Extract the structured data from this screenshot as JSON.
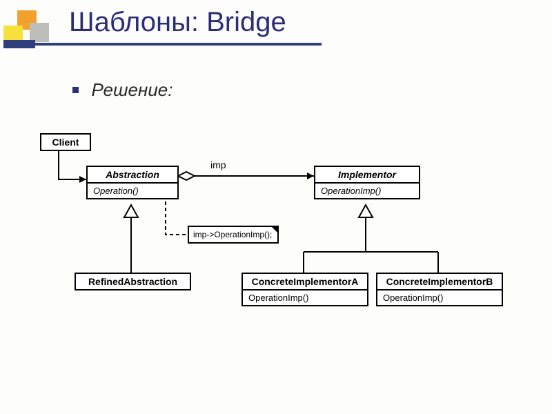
{
  "title": "Шаблоны: Bridge",
  "subtitle": "Решение:",
  "diagram": {
    "client": {
      "name": "Client"
    },
    "abstraction": {
      "name": "Abstraction",
      "method": "Operation()"
    },
    "refined": {
      "name": "RefinedAbstraction"
    },
    "implementor": {
      "name": "Implementor",
      "method": "OperationImp()"
    },
    "concreteA": {
      "name": "ConcreteImplementorA",
      "method": "OperationImp()"
    },
    "concreteB": {
      "name": "ConcreteImplementorB",
      "method": "OperationImp()"
    },
    "aggLabel": "imp",
    "note": "imp->OperationImp();"
  }
}
